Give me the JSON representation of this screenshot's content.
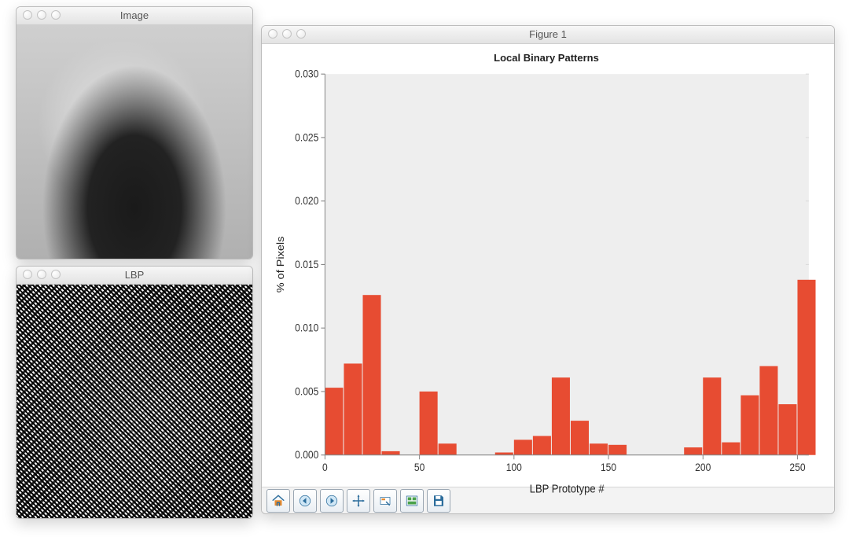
{
  "windows": {
    "image": {
      "title": "Image"
    },
    "lbp": {
      "title": "LBP"
    },
    "figure": {
      "title": "Figure 1"
    }
  },
  "toolbar": {
    "home": "Home",
    "back": "Back",
    "forward": "Forward",
    "pan": "Pan",
    "zoom": "Zoom",
    "config": "Configure subplots",
    "save": "Save"
  },
  "chart_data": {
    "type": "bar",
    "title": "Local Binary Patterns",
    "xlabel": "LBP Prototype #",
    "ylabel": "% of Pixels",
    "xlim": [
      0,
      256
    ],
    "ylim": [
      0,
      0.03
    ],
    "xticks": [
      0,
      50,
      100,
      150,
      200,
      250
    ],
    "yticks": [
      0.0,
      0.005,
      0.01,
      0.015,
      0.02,
      0.025,
      0.03
    ],
    "bin_width": 10,
    "categories": [
      0,
      10,
      20,
      30,
      40,
      50,
      60,
      70,
      80,
      90,
      100,
      110,
      120,
      130,
      140,
      150,
      160,
      170,
      180,
      190,
      200,
      210,
      220,
      230,
      240,
      250
    ],
    "values": [
      0.0053,
      0.0072,
      0.0126,
      0.0003,
      0.0,
      0.005,
      0.0009,
      0.0,
      0.0,
      0.0002,
      0.0012,
      0.0015,
      0.0061,
      0.0027,
      0.0009,
      0.0008,
      0.0,
      0.0,
      0.0,
      0.0006,
      0.0061,
      0.001,
      0.0047,
      0.007,
      0.004,
      0.0138
    ]
  }
}
